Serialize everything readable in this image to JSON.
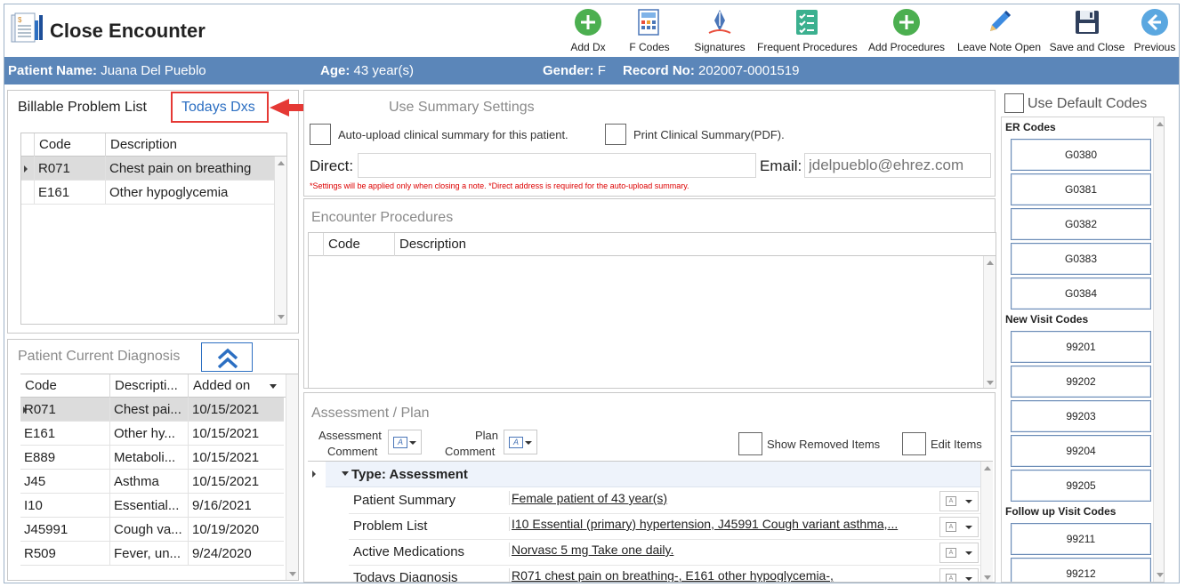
{
  "app": {
    "title": "Close Encounter"
  },
  "toolbar": {
    "add_dx": "Add Dx",
    "f_codes": "F Codes",
    "signatures": "Signatures",
    "frequent_procedures": "Frequent Procedures",
    "add_procedures": "Add Procedures",
    "leave_note_open": "Leave Note Open",
    "save_and_close": "Save and Close",
    "previous": "Previous"
  },
  "patient": {
    "name_label": "Patient Name:",
    "name": "Juana Del Pueblo",
    "age_label": "Age:",
    "age": "43 year(s)",
    "gender_label": "Gender:",
    "gender": "F",
    "record_label": "Record No:",
    "record": "202007-0001519"
  },
  "billable": {
    "title": "Billable Problem List",
    "tab_todays": "Todays Dxs",
    "columns": [
      "Code",
      "Description"
    ],
    "rows": [
      {
        "code": "R071",
        "desc": "Chest pain on breathing"
      },
      {
        "code": "E161",
        "desc": "Other hypoglycemia"
      }
    ]
  },
  "current_dx": {
    "title": "Patient Current Diagnosis",
    "columns": [
      "Code",
      "Descripti...",
      "Added on"
    ],
    "rows": [
      {
        "code": "R071",
        "desc": "Chest pai...",
        "date": "10/15/2021"
      },
      {
        "code": "E161",
        "desc": "Other hy...",
        "date": "10/15/2021"
      },
      {
        "code": "E889",
        "desc": "Metaboli...",
        "date": "10/15/2021"
      },
      {
        "code": "J45",
        "desc": "Asthma",
        "date": "10/15/2021"
      },
      {
        "code": "I10",
        "desc": "Essential...",
        "date": "9/16/2021"
      },
      {
        "code": "J45991",
        "desc": "Cough va...",
        "date": "10/19/2020"
      },
      {
        "code": "R509",
        "desc": "Fever, un...",
        "date": "9/24/2020"
      }
    ]
  },
  "summary": {
    "title": "Use Summary Settings",
    "auto_upload": "Auto-upload clinical summary for this patient.",
    "print_summary": "Print Clinical Summary(PDF).",
    "direct_label": "Direct:",
    "direct_value": "",
    "email_label": "Email:",
    "email_placeholder": "jdelpueblo@ehrez.com",
    "note": "*Settings will be applied only when closing a note.   *Direct address is required for the auto-upload summary."
  },
  "procedures": {
    "title": "Encounter Procedures",
    "columns": [
      "Code",
      "Description"
    ]
  },
  "assessment": {
    "title": "Assessment / Plan",
    "assessment_comment_1": "Assessment",
    "assessment_comment_2": "Comment",
    "plan_comment_1": "Plan",
    "plan_comment_2": "Comment",
    "show_removed": "Show Removed Items",
    "edit_items": "Edit Items",
    "group_label": "Type: Assessment",
    "rows": [
      {
        "key": "Patient Summary",
        "value": "Female patient of 43 year(s)"
      },
      {
        "key": "Problem List",
        "value": "I10 Essential (primary) hypertension, J45991 Cough variant asthma,..."
      },
      {
        "key": "Active Medications",
        "value": "Norvasc 5 mg Take one daily. "
      },
      {
        "key": "Todays Diagnosis",
        "value": "R071 chest pain on breathing-, E161 other hypoglycemia-,"
      }
    ]
  },
  "codes": {
    "use_default": "Use Default Codes",
    "er_title": "ER Codes",
    "er": [
      "G0380",
      "G0381",
      "G0382",
      "G0383",
      "G0384"
    ],
    "new_title": "New Visit Codes",
    "new": [
      "99201",
      "99202",
      "99203",
      "99204",
      "99205"
    ],
    "follow_title": "Follow up Visit Codes",
    "follow": [
      "99211",
      "99212"
    ]
  },
  "colors": {
    "patient_bar": "#5b86b9",
    "accent_blue": "#2c6fc2",
    "highlight_red": "#e53935",
    "button_green": "#4caf50"
  }
}
